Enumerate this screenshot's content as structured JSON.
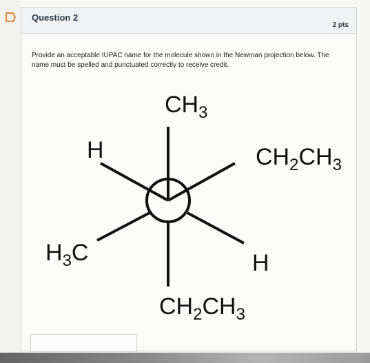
{
  "question": {
    "title": "Question 2",
    "points": "2 pts",
    "prompt": "Provide an acceptable IUPAC name for the molecule shown in the Newman projection below. The name must be spelled and punctuated correctly to receive credit."
  },
  "newman_projection": {
    "front_top": "CH",
    "front_top_sub": "3",
    "front_left": "H",
    "front_right": "CH",
    "front_right_sub1": "2",
    "front_right_mid": "CH",
    "front_right_sub2": "3",
    "back_left": "H",
    "back_left_sub": "3",
    "back_left_c": "C",
    "back_right": "H",
    "bottom": "CH",
    "bottom_sub1": "2",
    "bottom_mid": "CH",
    "bottom_sub2": "3"
  },
  "icons": {
    "flag": "flag-icon"
  },
  "colors": {
    "background": "#f7f7f5",
    "header": "#f1f2f3",
    "text": "#2d3b45",
    "accent": "#e66000"
  },
  "answer": {
    "value": ""
  }
}
